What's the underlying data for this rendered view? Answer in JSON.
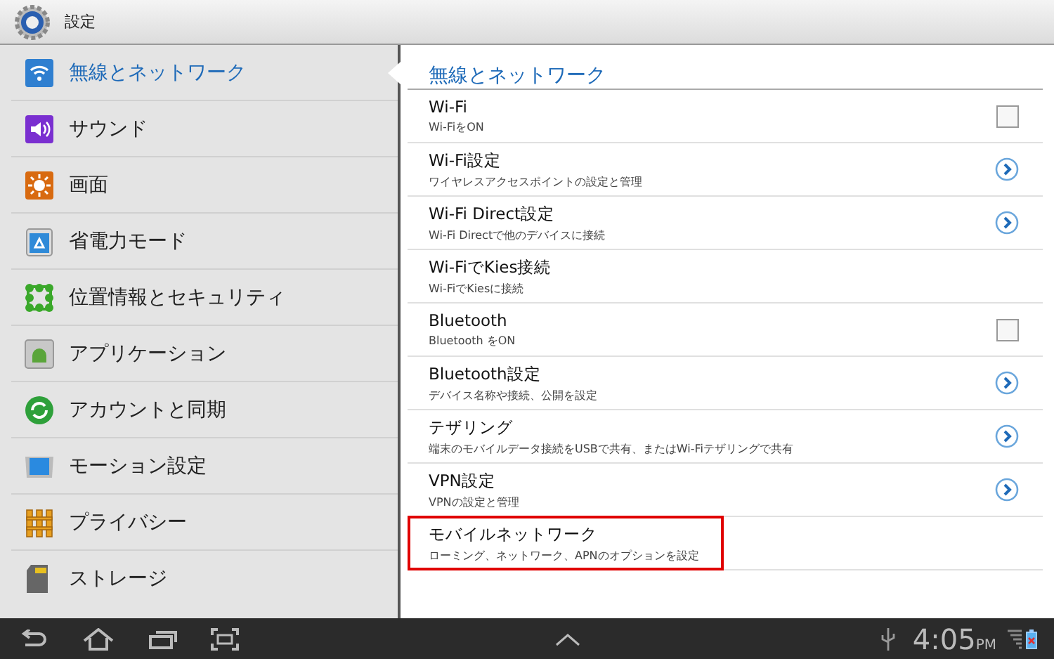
{
  "app_bar": {
    "title": "設定"
  },
  "sidebar": {
    "items": [
      {
        "label": "無線とネットワーク",
        "selected": true
      },
      {
        "label": "サウンド",
        "selected": false
      },
      {
        "label": "画面",
        "selected": false
      },
      {
        "label": "省電力モード",
        "selected": false
      },
      {
        "label": "位置情報とセキュリティ",
        "selected": false
      },
      {
        "label": "アプリケーション",
        "selected": false
      },
      {
        "label": "アカウントと同期",
        "selected": false
      },
      {
        "label": "モーション設定",
        "selected": false
      },
      {
        "label": "プライバシー",
        "selected": false
      },
      {
        "label": "ストレージ",
        "selected": false
      }
    ]
  },
  "panel": {
    "title": "無線とネットワーク",
    "items": [
      {
        "kind": "checkbox",
        "title": "Wi-Fi",
        "summary": "Wi-FiをON",
        "checked": false
      },
      {
        "kind": "link",
        "title": "Wi-Fi設定",
        "summary": "ワイヤレスアクセスポイントの設定と管理"
      },
      {
        "kind": "link",
        "title": "Wi-Fi Direct設定",
        "summary": "Wi-Fi Directで他のデバイスに接続"
      },
      {
        "kind": "plain",
        "title": "Wi-FiでKies接続",
        "summary": "Wi-FiでKiesに接続"
      },
      {
        "kind": "checkbox",
        "title": "Bluetooth",
        "summary": "Bluetooth をON",
        "checked": false
      },
      {
        "kind": "link",
        "title": "Bluetooth設定",
        "summary": "デバイス名称や接続、公開を設定"
      },
      {
        "kind": "link",
        "title": "テザリング",
        "summary": "端末のモバイルデータ接続をUSBで共有、またはWi-Fiテザリングで共有"
      },
      {
        "kind": "link",
        "title": "VPN設定",
        "summary": "VPNの設定と管理"
      },
      {
        "kind": "plain",
        "title": "モバイルネットワーク",
        "summary": "ローミング、ネットワーク、APNのオプションを設定",
        "highlighted": true
      }
    ]
  },
  "nav_bar": {
    "time": "4:05",
    "meridiem": "PM"
  }
}
